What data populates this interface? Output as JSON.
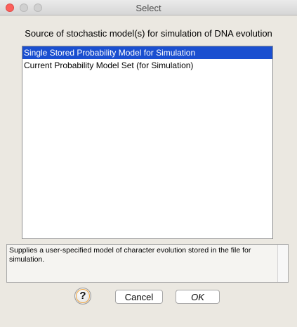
{
  "window": {
    "title": "Select"
  },
  "prompt": "Source of stochastic model(s) for simulation of DNA evolution",
  "list": {
    "items": [
      {
        "label": "Single Stored Probability Model for Simulation",
        "selected": true
      },
      {
        "label": "Current Probability Model Set (for Simulation)",
        "selected": false
      }
    ]
  },
  "description": "Supplies a user-specified model of character evolution stored in the file for simulation.",
  "buttons": {
    "help": "?",
    "cancel": "Cancel",
    "ok": "OK"
  },
  "colors": {
    "selection": "#1a4fd0",
    "close_button": "#fc605c",
    "background": "#ebe8e1"
  }
}
